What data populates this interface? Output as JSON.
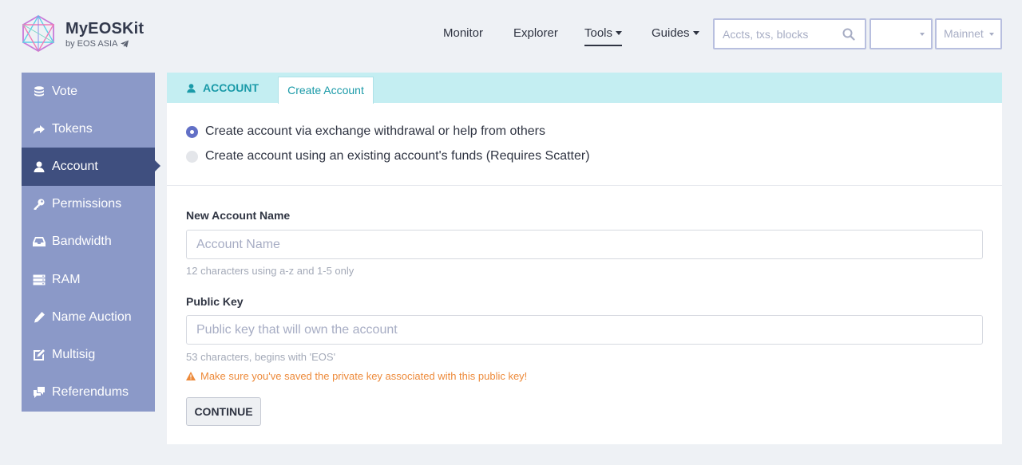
{
  "brand": {
    "title": "MyEOSKit",
    "subtitle": "by EOS ASIA"
  },
  "nav": {
    "items": [
      {
        "label": "Monitor"
      },
      {
        "label": "Explorer"
      },
      {
        "label": "Tools"
      },
      {
        "label": "Guides"
      }
    ],
    "search_placeholder": "Accts, txs, blocks",
    "network_label": "Mainnet",
    "language_label": ""
  },
  "sidebar": {
    "items": [
      {
        "label": "Vote",
        "icon": "coins-icon"
      },
      {
        "label": "Tokens",
        "icon": "arrow-share-icon"
      },
      {
        "label": "Account",
        "icon": "user-icon"
      },
      {
        "label": "Permissions",
        "icon": "key-icon"
      },
      {
        "label": "Bandwidth",
        "icon": "inbox-icon"
      },
      {
        "label": "RAM",
        "icon": "server-icon"
      },
      {
        "label": "Name Auction",
        "icon": "pencil-icon"
      },
      {
        "label": "Multisig",
        "icon": "edit-document-icon"
      },
      {
        "label": "Referendums",
        "icon": "comments-icon"
      }
    ],
    "active_index": 2
  },
  "main": {
    "section_label": "ACCOUNT",
    "active_tab": "Create Account",
    "radio_options": [
      {
        "label": "Create account via exchange withdrawal or help from others",
        "selected": true
      },
      {
        "label": "Create account using an existing account's funds (Requires Scatter)",
        "selected": false
      }
    ],
    "fields": {
      "account_name": {
        "label": "New Account Name",
        "placeholder": "Account Name",
        "value": "",
        "help": "12 characters using a-z and 1-5 only"
      },
      "public_key": {
        "label": "Public Key",
        "placeholder": "Public key that will own the account",
        "value": "",
        "help": "53 characters, begins with 'EOS'",
        "warning": "Make sure you've saved the private key associated with this public key!"
      }
    },
    "continue_label": "CONTINUE"
  },
  "colors": {
    "sidebar_bg": "#8b99c8",
    "sidebar_active": "#3f4f7f",
    "tab_bar": "#c4eef2",
    "accent_teal": "#1a9aa8",
    "radio_on": "#6270c6",
    "warning": "#ed8a3a"
  }
}
